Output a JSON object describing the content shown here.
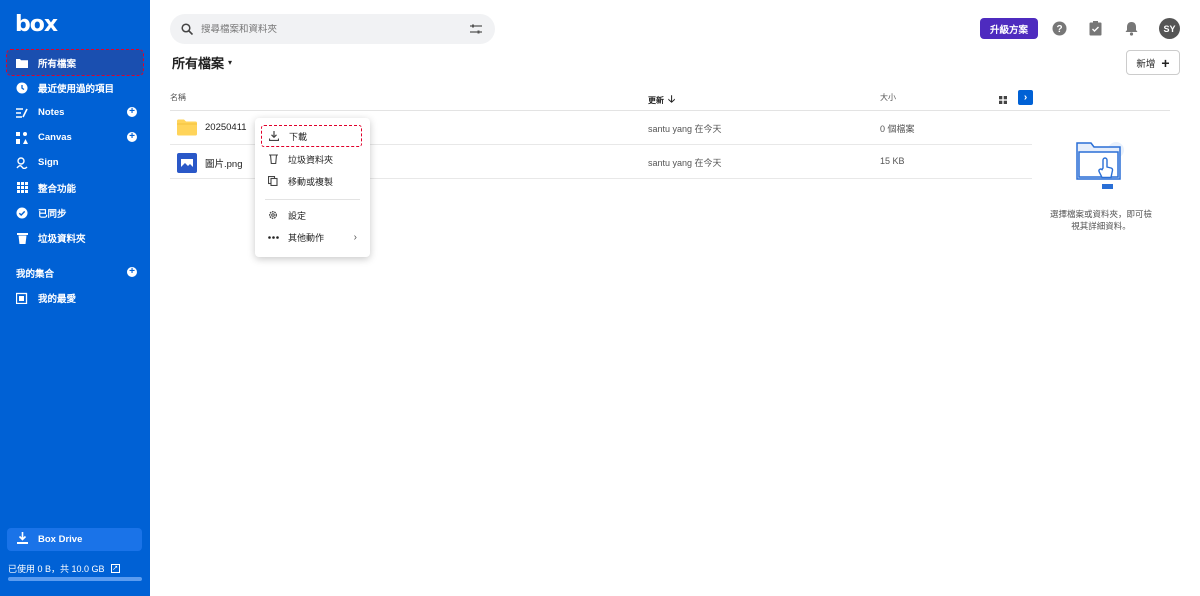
{
  "sidebar": {
    "logo": "box",
    "nav": [
      {
        "label": "所有檔案",
        "icon": "folder-icon",
        "active": true
      },
      {
        "label": "最近使用過的項目",
        "icon": "clock-icon"
      },
      {
        "label": "Notes",
        "icon": "notes-icon",
        "add": true
      },
      {
        "label": "Canvas",
        "icon": "canvas-icon",
        "add": true
      },
      {
        "label": "Sign",
        "icon": "sign-icon"
      },
      {
        "label": "整合功能",
        "icon": "apps-grid-icon"
      },
      {
        "label": "已同步",
        "icon": "synced-check-icon"
      },
      {
        "label": "垃圾資料夾",
        "icon": "trash-icon"
      }
    ],
    "collections_title": "我的集合",
    "favorites": "我的最愛",
    "box_drive": "Box Drive",
    "usage": "已使用 0 B，共 10.0 GB",
    "usage_fraction": 0.0
  },
  "topbar": {
    "search_placeholder": "搜尋檔案和資料夾",
    "upgrade_label": "升級方案",
    "avatar_initials": "SY"
  },
  "header": {
    "title": "所有檔案",
    "new_label": "新增"
  },
  "table": {
    "columns": {
      "name": "名稱",
      "updated": "更新",
      "size": "大小"
    },
    "sorted_by": "updated",
    "rows": [
      {
        "name": "20250411",
        "type": "folder",
        "updated": "santu yang 在今天",
        "size": "0 個檔案"
      },
      {
        "name": "圖片.png",
        "type": "image",
        "updated": "santu yang 在今天",
        "size": "15 KB"
      }
    ]
  },
  "context_menu": {
    "items": [
      {
        "label": "下載",
        "icon": "download-icon",
        "highlighted": true
      },
      {
        "label": "垃圾資料夾",
        "icon": "trash-icon"
      },
      {
        "label": "移動或複製",
        "icon": "copy-icon"
      },
      {
        "label": "設定",
        "icon": "gear-icon"
      },
      {
        "label": "其他動作",
        "icon": "more-icon",
        "submenu": true
      }
    ]
  },
  "details_panel": {
    "empty_text": "選擇檔案或資料夾，即可檢視其詳細資料。"
  },
  "colors": {
    "sidebar": "#0061d5",
    "upgrade": "#4e2bbf",
    "highlight": "#e0002a",
    "folder": "#ffd45a"
  }
}
